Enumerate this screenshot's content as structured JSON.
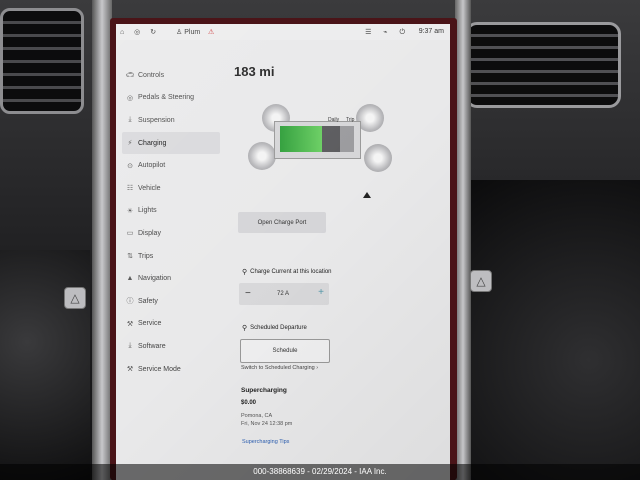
{
  "status_bar": {
    "icons": "⌂ ◎ ↻",
    "user": "♙ Plum",
    "alert": "⚠",
    "right_icons": "☰ ⌁ ⏻",
    "time": "9:37 am"
  },
  "sidebar": {
    "items": [
      {
        "label": "Controls",
        "icon": "car-icon"
      },
      {
        "label": "Pedals & Steering",
        "icon": "steering-icon"
      },
      {
        "label": "Suspension",
        "icon": "suspension-icon"
      },
      {
        "label": "Charging",
        "icon": "lightning-icon"
      },
      {
        "label": "Autopilot",
        "icon": "autopilot-icon"
      },
      {
        "label": "Vehicle",
        "icon": "vehicle-icon"
      },
      {
        "label": "Lights",
        "icon": "sun-icon"
      },
      {
        "label": "Display",
        "icon": "display-icon"
      },
      {
        "label": "Trips",
        "icon": "trips-icon"
      },
      {
        "label": "Navigation",
        "icon": "navigation-icon"
      },
      {
        "label": "Safety",
        "icon": "safety-icon"
      },
      {
        "label": "Service",
        "icon": "wrench-icon"
      },
      {
        "label": "Software",
        "icon": "download-icon"
      },
      {
        "label": "Service Mode",
        "icon": "wrench-icon"
      }
    ],
    "active_index": 3
  },
  "charging": {
    "range": "183 mi",
    "battery_labels": {
      "daily": "Daily",
      "trip": "Trip"
    },
    "battery_level": 0.7,
    "open_port_label": "Open Charge Port",
    "current_label": "Charge Current at this location",
    "current_value": "72 A",
    "minus": "−",
    "plus": "+",
    "departure_label": "Scheduled Departure",
    "schedule_button": "Schedule",
    "switch_link": "Switch to Scheduled Charging ›",
    "supercharging": {
      "title": "Supercharging",
      "price": "$0.00",
      "location": "Pomona, CA",
      "date": "Fri, Nov 24 12:38 pm",
      "tips_link": "Supercharging Tips"
    }
  },
  "watermark": "000-38868639 - 02/29/2024 - IAA Inc.",
  "colors": {
    "screen_bg": "#e9e9ea",
    "battery_green": "#2f9e3a",
    "link_blue": "#2a5db0",
    "screen_border": "#4a1418"
  }
}
